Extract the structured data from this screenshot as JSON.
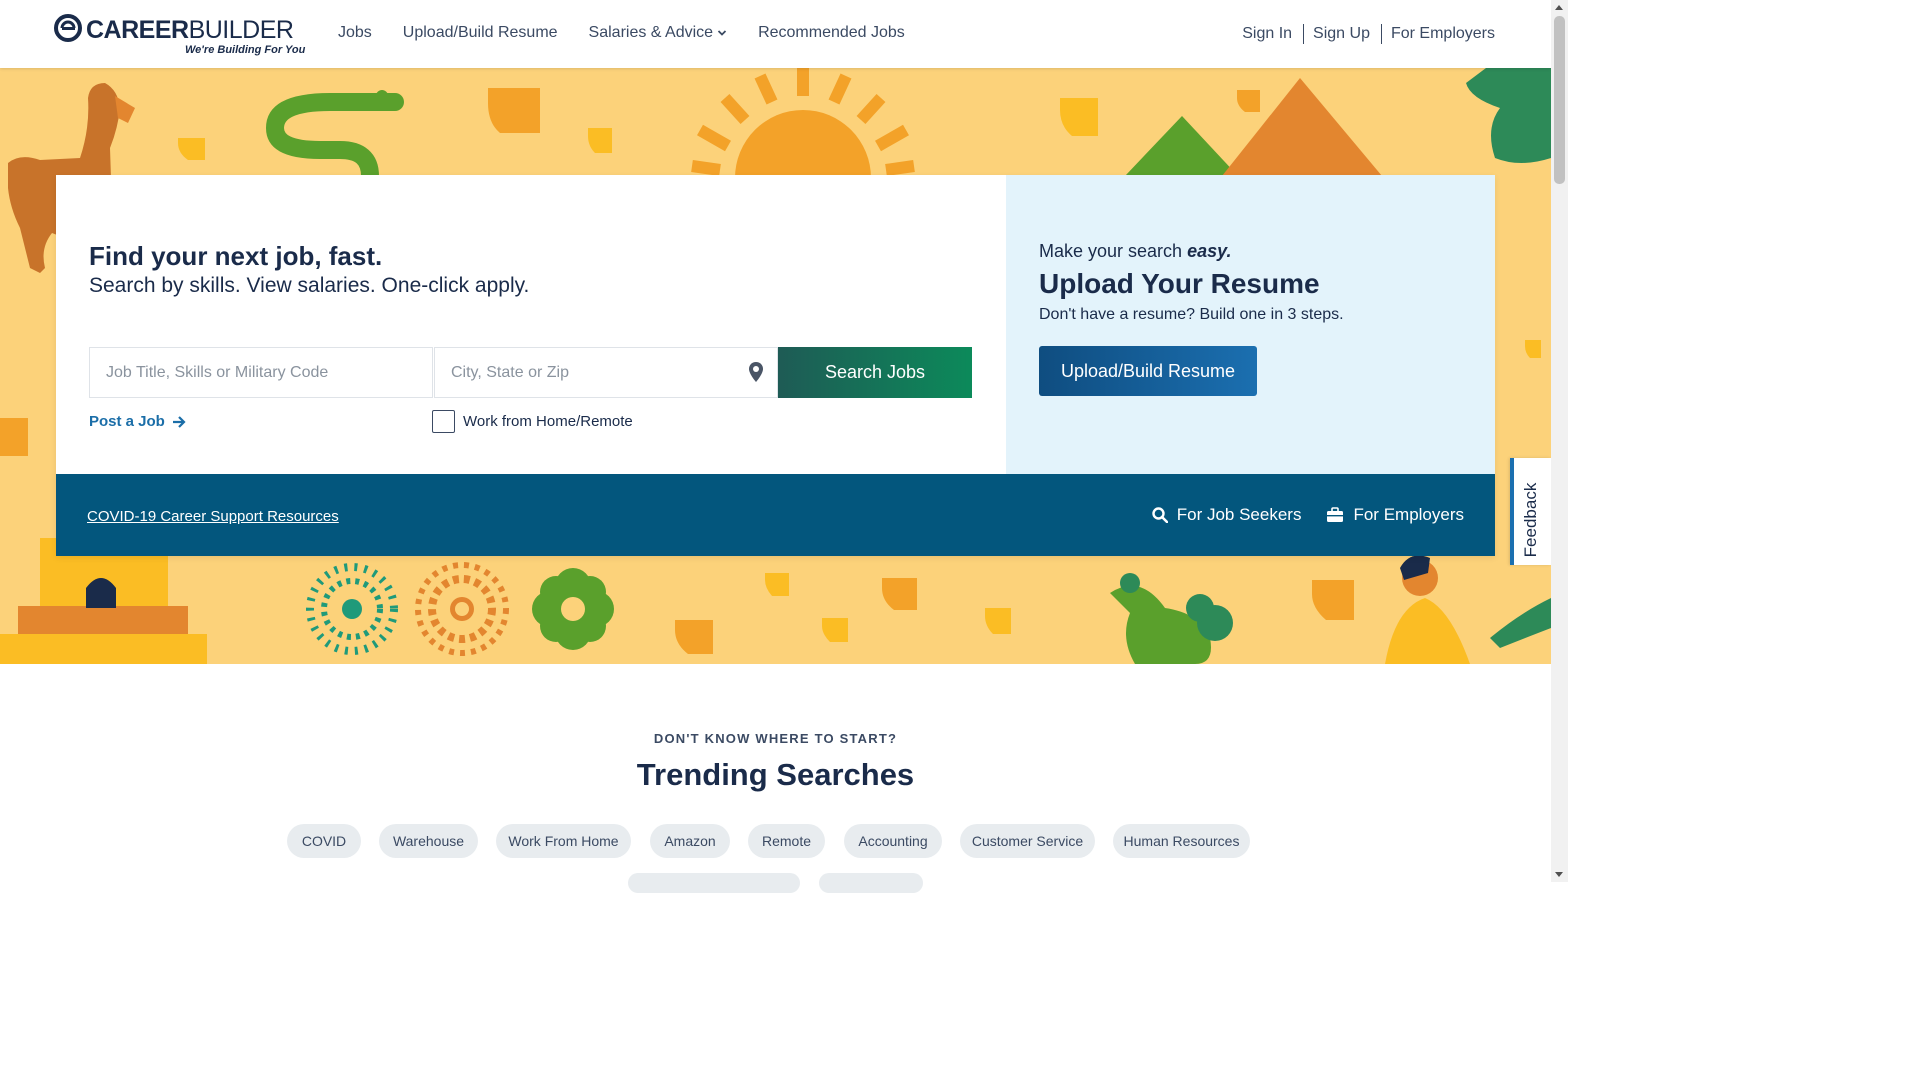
{
  "header": {
    "logo": {
      "word_bold": "CAREER",
      "word_light": "BUILDER",
      "tagline": "We're Building For You"
    },
    "nav": [
      {
        "label": "Jobs"
      },
      {
        "label": "Upload/Build Resume"
      },
      {
        "label": "Salaries & Advice"
      },
      {
        "label": "Recommended Jobs"
      }
    ],
    "auth": {
      "sign_in": "Sign In",
      "sign_up": "Sign Up",
      "employers": "For Employers"
    }
  },
  "search": {
    "headline": "Find your next job, fast.",
    "subheadline": "Search by skills. View salaries. One-click apply.",
    "job_placeholder": "Job Title, Skills or Military Code",
    "job_value": "",
    "location_placeholder": "City, State or Zip",
    "location_value": "",
    "button": "Search Jobs",
    "post_job": "Post a Job",
    "remote_label": "Work from Home/Remote",
    "remote_checked": false
  },
  "resume": {
    "small_prefix": "Make your search ",
    "small_emph": "easy.",
    "title": "Upload Your Resume",
    "description": "Don't have a resume? Build one in 3 steps.",
    "button": "Upload/Build Resume"
  },
  "bar": {
    "covid": "COVID-19 Career Support Resources",
    "job_seekers": "For Job Seekers",
    "employers": "For Employers"
  },
  "feedback": "Feedback",
  "trending": {
    "eyebrow": "DON'T KNOW WHERE TO START?",
    "title": "Trending Searches",
    "chips": [
      "COVID",
      "Warehouse",
      "Work From Home",
      "Amazon",
      "Remote",
      "Accounting",
      "Customer Service",
      "Human Resources"
    ]
  },
  "colors": {
    "hero_bg": "#fcd27a",
    "navy": "#03567d",
    "search_green": "#0c8a5a",
    "upload_blue": "#1b6fb0",
    "resume_panel": "#e3f3fb"
  },
  "icons": [
    "careerbuilder-logo-icon",
    "chevron-down-icon",
    "map-pin-icon",
    "arrow-right-icon",
    "search-icon",
    "briefcase-icon"
  ]
}
